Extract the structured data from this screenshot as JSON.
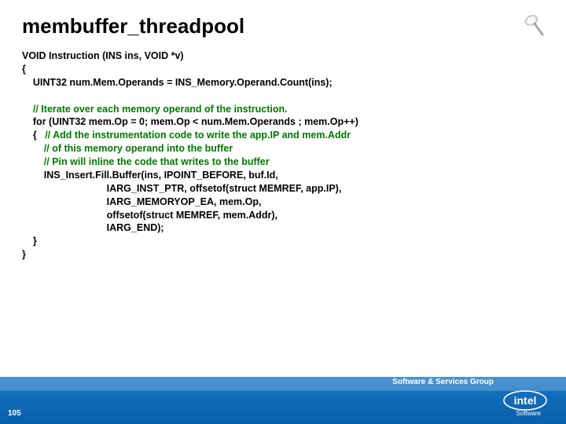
{
  "title": "membuffer_threadpool",
  "code": {
    "l1": "VOID Instruction (INS ins, VOID *v)",
    "l2": "{",
    "l3": "    UINT32 num.Mem.Operands = INS_Memory.Operand.Count(ins);",
    "l4": "",
    "c1": "    // Iterate over each memory operand of the instruction.",
    "l5": "    for (UINT32 mem.Op = 0; mem.Op < num.Mem.Operands ; mem.Op++)",
    "l6a": "    {   ",
    "c2": "// Add the instrumentation code to write the app.IP and mem.Addr",
    "c3": "        // of this memory operand into the buffer",
    "c4": "        // Pin will inline the code that writes to the buffer",
    "l7": "        INS_Insert.Fill.Buffer(ins, IPOINT_BEFORE, buf.Id,",
    "l8": "                               IARG_INST_PTR, offsetof(struct MEMREF, app.IP),",
    "l9": "                               IARG_MEMORYOP_EA, mem.Op,",
    "l10": "                               offsetof(struct MEMREF, mem.Addr),",
    "l11": "                               IARG_END);",
    "l12": "    }",
    "l13": "}"
  },
  "footer": {
    "group": "Software & Services Group",
    "slide_number": "105",
    "brand": "intel",
    "sub": "Software"
  }
}
